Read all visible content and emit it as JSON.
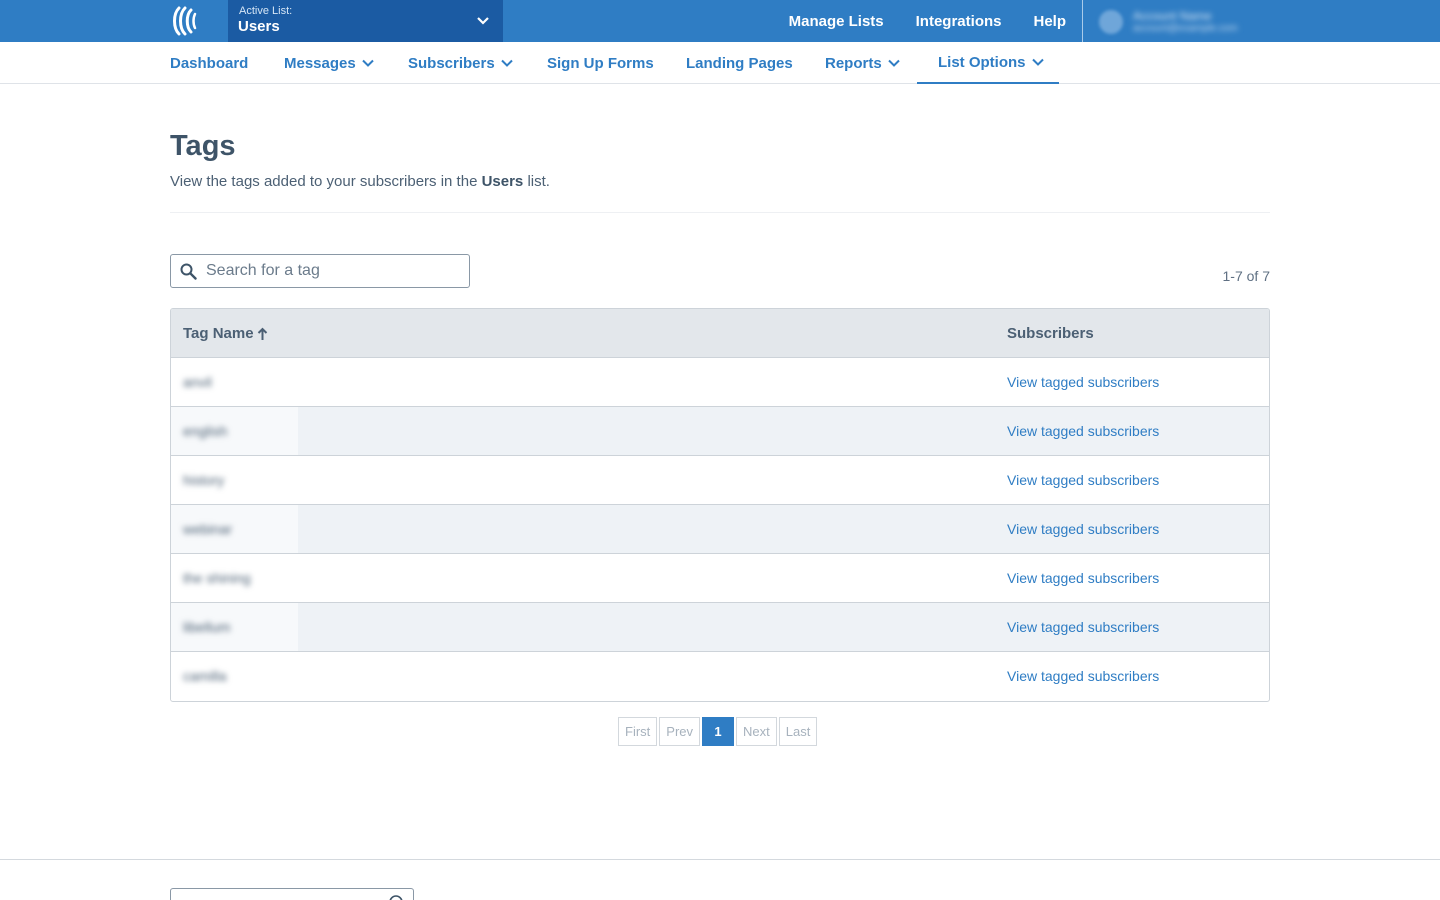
{
  "topbar": {
    "logo_icon": "aweber-logo-icon",
    "active_list_label": "Active List:",
    "active_list_value": "Users",
    "links": [
      "Manage Lists",
      "Integrations",
      "Help"
    ],
    "account_name": "Account Name",
    "account_email": "account@example.com"
  },
  "subnav": {
    "items": [
      "Dashboard",
      "Messages",
      "Subscribers",
      "Sign Up Forms",
      "Landing Pages",
      "Reports",
      "List Options"
    ],
    "active": "List Options"
  },
  "page": {
    "title": "Tags",
    "desc_before": "View the tags added to your subscribers in the ",
    "desc_list": "Users",
    "desc_after": " list."
  },
  "search": {
    "placeholder": "Search for a tag",
    "value": ""
  },
  "count": "1-7 of 7",
  "table": {
    "headers": {
      "name": "Tag Name",
      "subscribers": "Subscribers"
    },
    "sort": "ascending",
    "rows": [
      {
        "name": "anvil",
        "link": "View tagged subscribers"
      },
      {
        "name": "english",
        "link": "View tagged subscribers"
      },
      {
        "name": "history",
        "link": "View tagged subscribers"
      },
      {
        "name": "webinar",
        "link": "View tagged subscribers"
      },
      {
        "name": "the shining",
        "link": "View tagged subscribers"
      },
      {
        "name": "libellum",
        "link": "View tagged subscribers"
      },
      {
        "name": "camilla",
        "link": "View tagged subscribers"
      }
    ]
  },
  "pagination": {
    "first": "First",
    "prev": "Prev",
    "current": "1",
    "next": "Next",
    "last": "Last"
  },
  "colors": {
    "brand": "#2f7dc4",
    "brand_dark": "#1b5ba3",
    "text": "#3e5468",
    "header_bg": "#e3e7eb",
    "alt_row_bg": "#eef2f6"
  }
}
